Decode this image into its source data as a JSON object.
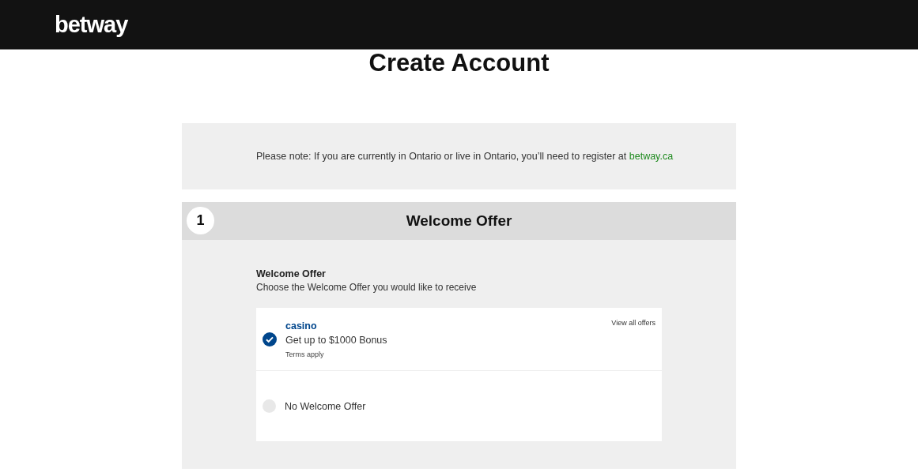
{
  "header": {
    "logo": "betway"
  },
  "page_title": "Create Account",
  "notice": {
    "text": "Please note: If you are currently in Ontario or live in Ontario, you’ll need to register at",
    "link": "betway.ca"
  },
  "step": {
    "number": "1",
    "title": "Welcome Offer",
    "heading": "Welcome Offer",
    "description": "Choose the Welcome Offer you would like to receive",
    "options": [
      {
        "kind": "offer",
        "selected": true,
        "brand": "casino",
        "title": "Get up to $1000 Bonus",
        "terms": "Terms apply",
        "link": "View all offers"
      },
      {
        "kind": "plain",
        "selected": false,
        "title": "No Welcome Offer"
      }
    ]
  }
}
